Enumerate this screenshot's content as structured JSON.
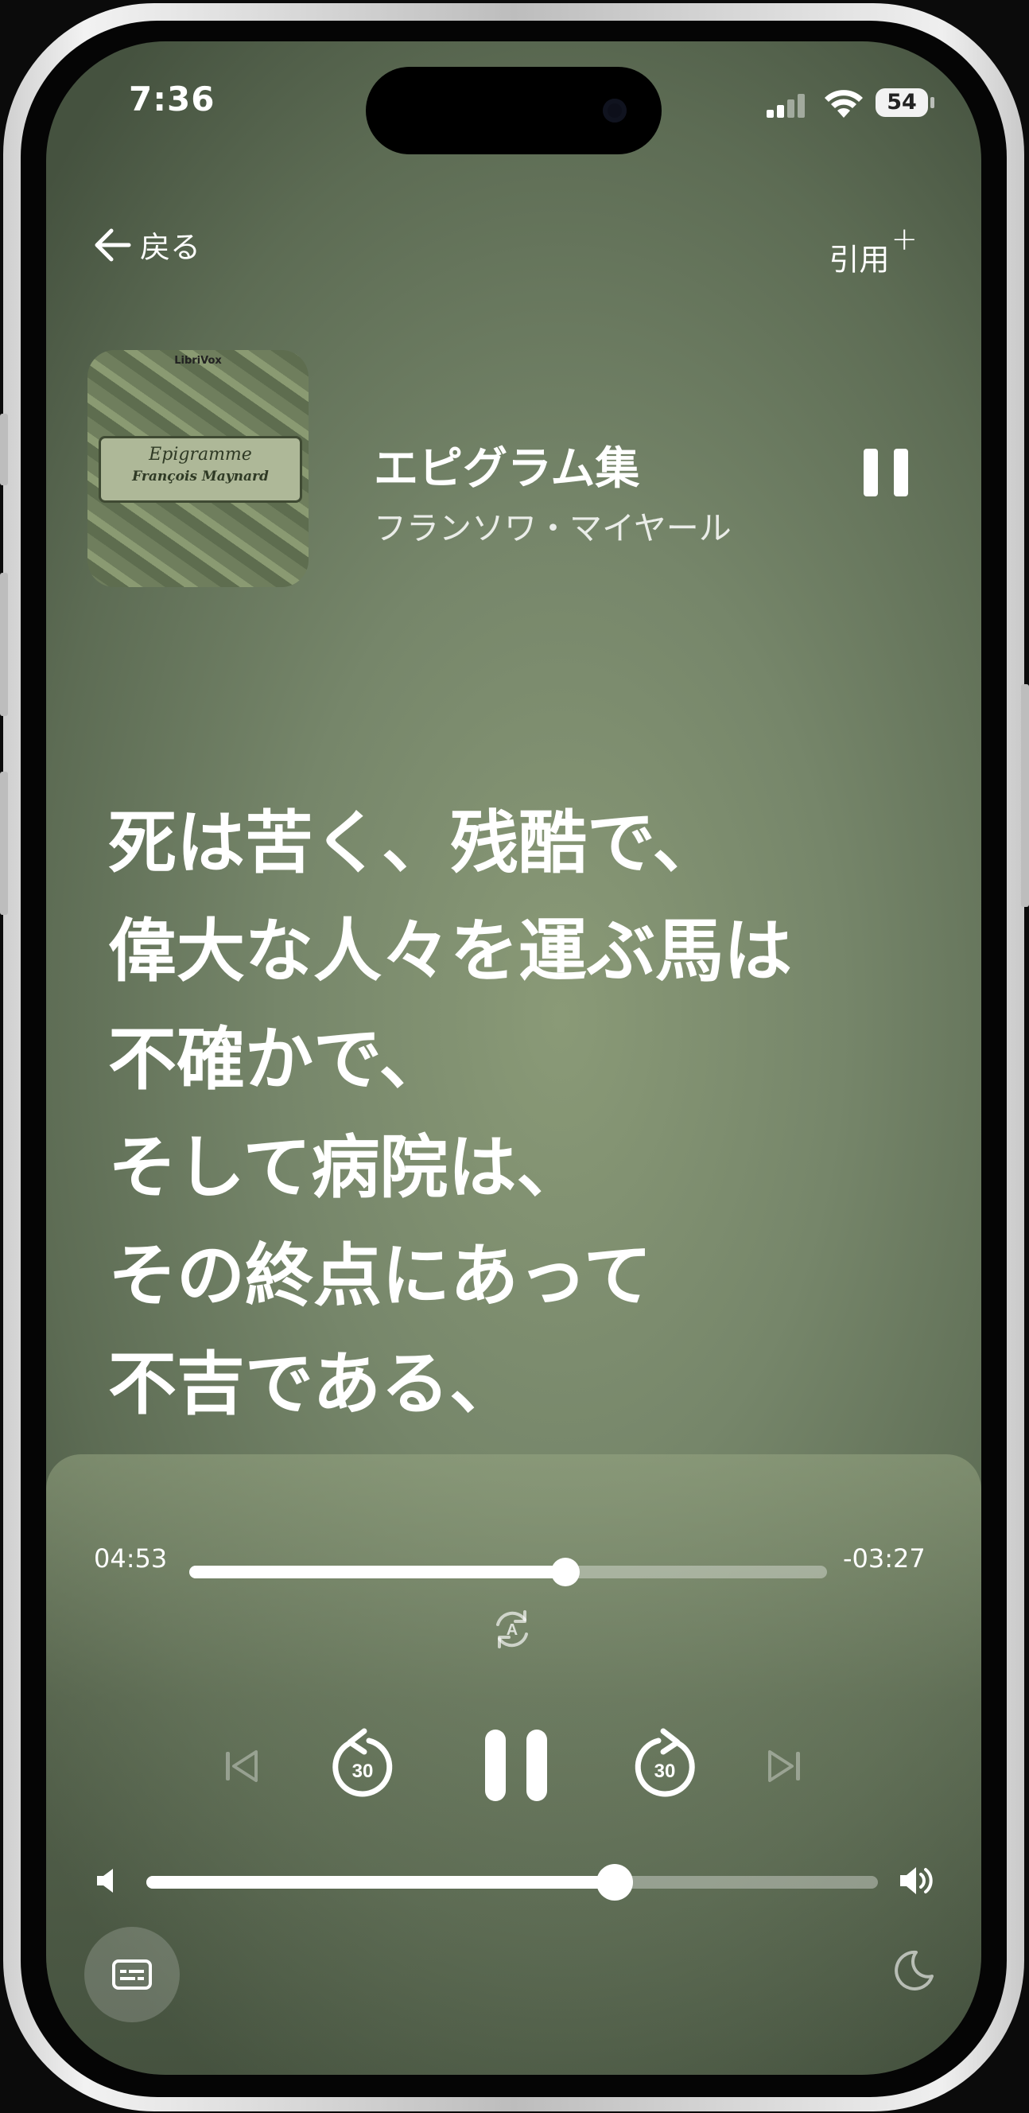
{
  "status_bar": {
    "time": "7:36",
    "battery": "54"
  },
  "nav": {
    "back_label": "戻る",
    "quote_label": "引用",
    "quote_plus": "+"
  },
  "book": {
    "title": "エピグラム集",
    "author": "フランソワ・マイヤール",
    "cover_brand": "LibriVox",
    "cover_title": "Epigramme",
    "cover_author": "François Maynard"
  },
  "lyrics": [
    "死は苦く、残酷で、",
    "偉大な人々を運ぶ馬は",
    "不確かで、",
    "そして病院は、",
    "その終点にあって",
    "不吉である、"
  ],
  "player": {
    "elapsed": "04:53",
    "remaining": "-03:27",
    "progress_fraction": 0.59,
    "skip_back_seconds": "30",
    "skip_forward_seconds": "30",
    "auto_label": "A",
    "volume_fraction": 0.64
  },
  "icons": {
    "back": "arrow-left-icon",
    "pause": "pause-icon",
    "previous": "skip-previous-icon",
    "next": "skip-next-icon",
    "rewind": "rewind-30-icon",
    "forward": "forward-30-icon",
    "auto_scroll": "auto-scroll-icon",
    "volume_low": "volume-low-icon",
    "volume_high": "volume-high-icon",
    "subtitles": "subtitles-icon",
    "sleep": "moon-icon"
  }
}
